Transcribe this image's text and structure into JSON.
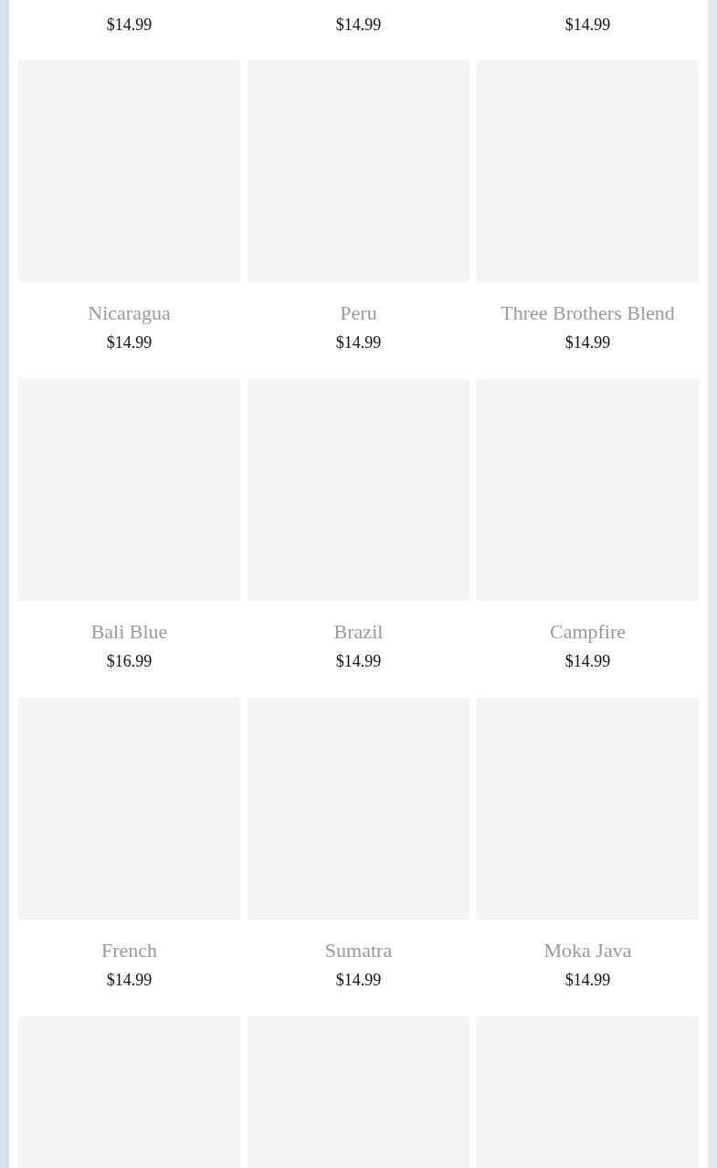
{
  "top_row": [
    {
      "price": "$14.99"
    },
    {
      "price": "$14.99"
    },
    {
      "price": "$14.99"
    }
  ],
  "products": [
    {
      "kind": "picture",
      "name": "Nicaragua",
      "price": "$14.99"
    },
    {
      "kind": "picture",
      "name": "Peru",
      "price": "$14.99"
    },
    {
      "kind": "picture",
      "name": "Three Brothers Blend",
      "price": "$14.99"
    },
    {
      "kind": "picture",
      "name": "Bali Blue",
      "price": "$16.99"
    },
    {
      "kind": "picture",
      "name": "Brazil",
      "price": "$14.99"
    },
    {
      "kind": "picture",
      "name": "Campfire",
      "price": "$14.99"
    },
    {
      "kind": "picture",
      "name": "French",
      "price": "$14.99"
    },
    {
      "kind": "picture",
      "name": "Sumatra",
      "price": "$14.99"
    },
    {
      "kind": "picture",
      "name": "Moka Java",
      "price": "$14.99"
    },
    {
      "kind": "picture"
    },
    {
      "kind": "picture"
    },
    {
      "kind": "picture"
    }
  ]
}
